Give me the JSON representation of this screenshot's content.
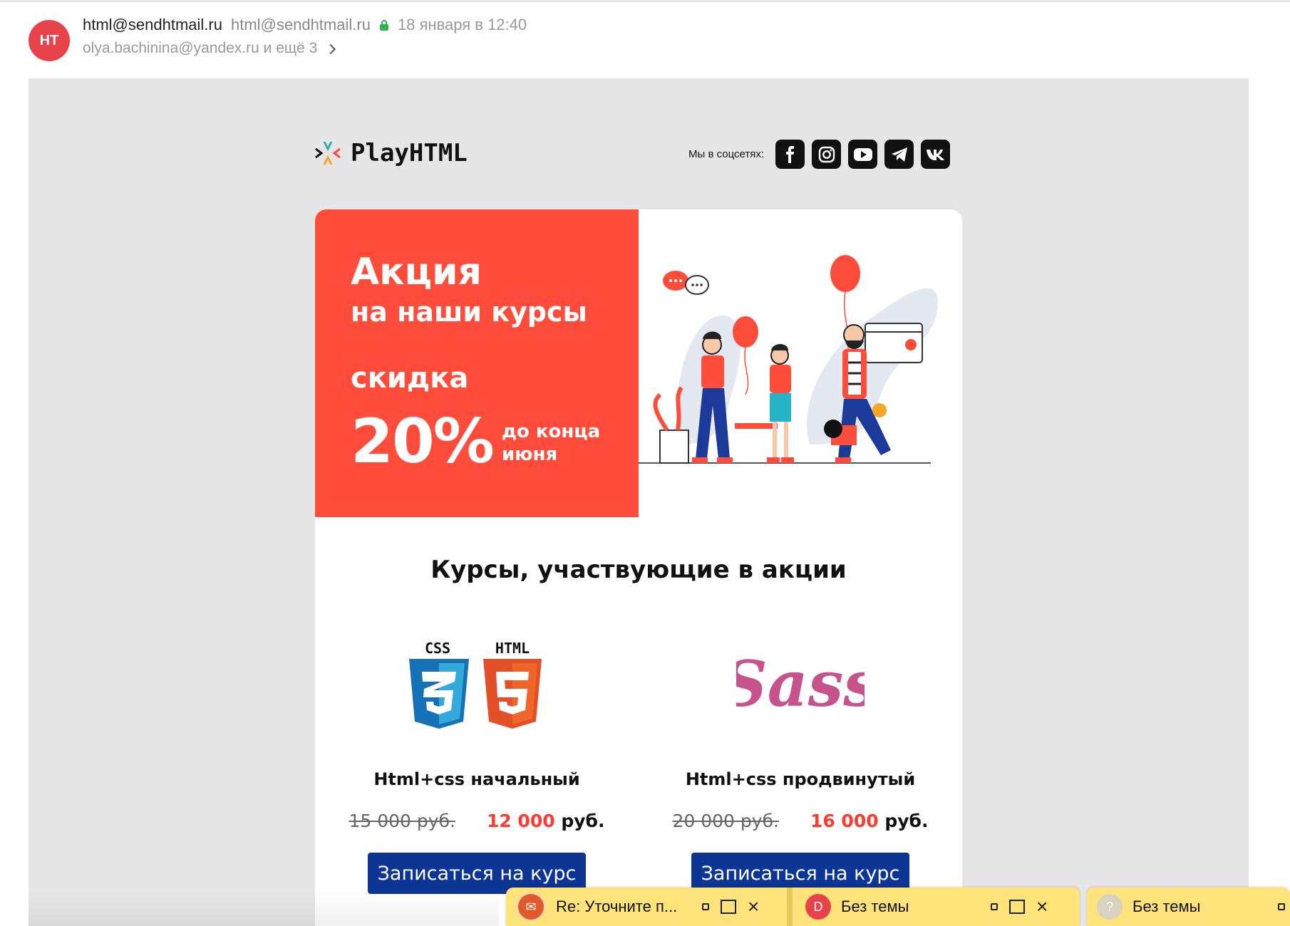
{
  "header": {
    "avatar_initials": "HT",
    "from_name": "html@sendhtmail.ru",
    "from_email": "html@sendhtmail.ru",
    "date": "18 января в 12:40",
    "recipients": "olya.bachinina@yandex.ru и ещё 3"
  },
  "email": {
    "logo_text": "PlayHTML",
    "social_label": "Мы в соцсетях:",
    "social_icons": [
      "facebook-icon",
      "instagram-icon",
      "youtube-icon",
      "telegram-icon",
      "vk-icon"
    ],
    "promo": {
      "title": "Акция",
      "subtitle": "на наши курсы",
      "discount_label": "скидка",
      "percent": "20%",
      "until": "до конца июня",
      "color": "#ff4c3b"
    },
    "section_title": "Курсы, участвующие в акции",
    "courses": [
      {
        "logo_labels": [
          "CSS",
          "HTML"
        ],
        "name": "Html+css начальный",
        "old_price": "15 000 руб.",
        "new_price": "12 000",
        "currency": "руб.",
        "button": "Записаться на курс"
      },
      {
        "logo_labels": [
          "Sass"
        ],
        "name": "Html+css продвинутый",
        "old_price": "20 000 руб.",
        "new_price": "16 000",
        "currency": "руб.",
        "button": "Записаться на курс"
      }
    ],
    "button_color": "#0d3594"
  },
  "taskbar": {
    "items": [
      {
        "label": "Re: Уточните п...",
        "icon_color": "#e05a2b"
      },
      {
        "label": "Без темы",
        "icon_letter": "D",
        "icon_color": "#e8434b"
      },
      {
        "label": "Без темы",
        "icon_letter": "?",
        "icon_color": "#d8d3c0"
      }
    ]
  }
}
